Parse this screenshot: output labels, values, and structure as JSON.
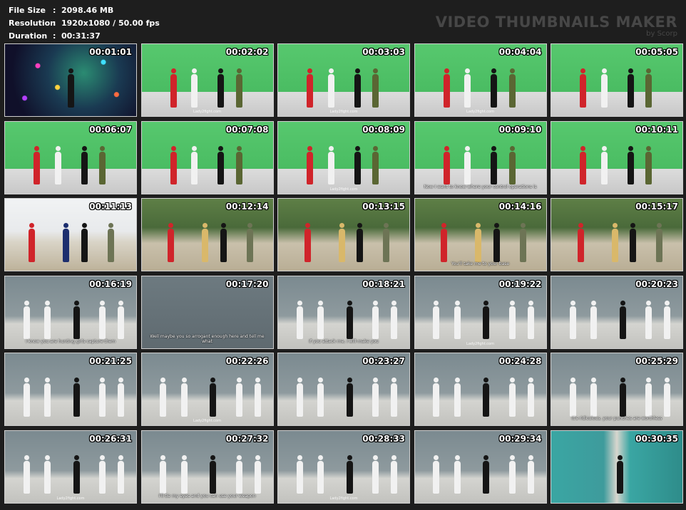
{
  "header": {
    "file_size_label": "File Size",
    "file_size": "2098.46 MB",
    "resolution_label": "Resolution",
    "resolution": "1920x1080 / 50.00 fps",
    "duration_label": "Duration",
    "duration": "00:31:37",
    "separator": ":"
  },
  "watermark": {
    "title": "VIDEO THUMBNAILS MAKER",
    "subtitle": "by Scorp"
  },
  "colors": {
    "background": "#1e1e1e",
    "wall_green": "#4fbf64",
    "mask_red": "#d0242a",
    "gym_wall": "#7b8a90"
  },
  "thumbnails": [
    {
      "time": "00:01:01",
      "scene": "club",
      "brand": "",
      "subtitle": ""
    },
    {
      "time": "00:02:02",
      "scene": "green",
      "brand": "Lady2fight.com",
      "subtitle": ""
    },
    {
      "time": "00:03:03",
      "scene": "green",
      "brand": "Lady2fight.com",
      "subtitle": ""
    },
    {
      "time": "00:04:04",
      "scene": "green",
      "brand": "Lady2fight.com",
      "subtitle": ""
    },
    {
      "time": "00:05:05",
      "scene": "green",
      "brand": "",
      "subtitle": ""
    },
    {
      "time": "00:06:07",
      "scene": "green",
      "brand": "",
      "subtitle": ""
    },
    {
      "time": "00:07:08",
      "scene": "green",
      "brand": "",
      "subtitle": ""
    },
    {
      "time": "00:08:09",
      "scene": "green",
      "brand": "Lady2fight.com",
      "subtitle": ""
    },
    {
      "time": "00:09:10",
      "scene": "green",
      "brand": "Lady2fight.com",
      "subtitle": "Now I want to know where your control operations is"
    },
    {
      "time": "00:10:11",
      "scene": "green",
      "brand": "",
      "subtitle": ""
    },
    {
      "time": "00:11:13",
      "scene": "beach",
      "brand": "",
      "subtitle": ""
    },
    {
      "time": "00:12:14",
      "scene": "forest",
      "brand": "",
      "subtitle": ""
    },
    {
      "time": "00:13:15",
      "scene": "forest",
      "brand": "",
      "subtitle": ""
    },
    {
      "time": "00:14:16",
      "scene": "forest",
      "brand": "",
      "subtitle": "You'll take me to your base"
    },
    {
      "time": "00:15:17",
      "scene": "forest",
      "brand": "",
      "subtitle": ""
    },
    {
      "time": "00:16:19",
      "scene": "gym",
      "brand": "Lady2fight.com",
      "subtitle": "I know you are hunting girls capture them"
    },
    {
      "time": "00:17:20",
      "scene": "face",
      "brand": "",
      "subtitle": "Well maybe you so arrogant enough here and tell me what"
    },
    {
      "time": "00:18:21",
      "scene": "gym",
      "brand": "",
      "subtitle": "If you attack me, I will make you"
    },
    {
      "time": "00:19:22",
      "scene": "gym",
      "brand": "Lady2fight.com",
      "subtitle": ""
    },
    {
      "time": "00:20:23",
      "scene": "gym",
      "brand": "",
      "subtitle": ""
    },
    {
      "time": "00:21:25",
      "scene": "gym",
      "brand": "",
      "subtitle": ""
    },
    {
      "time": "00:22:26",
      "scene": "gym",
      "brand": "Lady2fight.com",
      "subtitle": ""
    },
    {
      "time": "00:23:27",
      "scene": "gym",
      "brand": "",
      "subtitle": ""
    },
    {
      "time": "00:24:28",
      "scene": "gym",
      "brand": "",
      "subtitle": ""
    },
    {
      "time": "00:25:29",
      "scene": "gym",
      "brand": "",
      "subtitle": "It's ridiculous, your punches are worthless"
    },
    {
      "time": "00:26:31",
      "scene": "gym",
      "brand": "Lady2fight.com",
      "subtitle": ""
    },
    {
      "time": "00:27:32",
      "scene": "gym",
      "brand": "",
      "subtitle": "I'll tie my eyes and you can use your weapon"
    },
    {
      "time": "00:28:33",
      "scene": "gym",
      "brand": "Lady2fight.com",
      "subtitle": ""
    },
    {
      "time": "00:29:34",
      "scene": "gym",
      "brand": "",
      "subtitle": ""
    },
    {
      "time": "00:30:35",
      "scene": "hall",
      "brand": "",
      "subtitle": ""
    }
  ]
}
